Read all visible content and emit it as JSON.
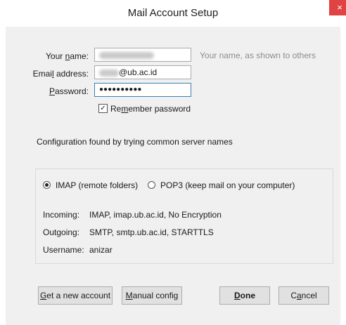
{
  "window": {
    "title": "Mail Account Setup",
    "close_glyph": "×"
  },
  "form": {
    "name_label_pre": "Your ",
    "name_label_u": "n",
    "name_label_post": "ame:",
    "name_value": "",
    "name_hint": "Your name, as shown to others",
    "email_label_pre": "Emai",
    "email_label_u": "l",
    "email_label_post": " address:",
    "email_value": "@ub.ac.id",
    "password_label_u": "P",
    "password_label_post": "assword:",
    "password_value": "●●●●●●●●●●",
    "remember_pre": "Re",
    "remember_u": "m",
    "remember_post": "ember password",
    "remember_checked": true
  },
  "status": {
    "message": "Configuration found by trying common server names"
  },
  "protocol": {
    "imap_label": "IMAP (remote folders)",
    "pop3_label": "POP3 (keep mail on your computer)",
    "selected": "imap"
  },
  "details": {
    "incoming_label": "Incoming:",
    "incoming_value": "IMAP, imap.ub.ac.id, No Encryption",
    "outgoing_label": "Outgoing:",
    "outgoing_value": "SMTP, smtp.ub.ac.id, STARTTLS",
    "username_label": "Username:",
    "username_value": "anizar"
  },
  "buttons": {
    "new_account_u": "G",
    "new_account_post": "et a new account",
    "manual_u": "M",
    "manual_post": "anual config",
    "done_u": "D",
    "done_post": "one",
    "cancel_pre": "C",
    "cancel_u": "a",
    "cancel_post": "ncel"
  },
  "colors": {
    "close": "#e04343",
    "focus_border": "#3c7fb1"
  }
}
